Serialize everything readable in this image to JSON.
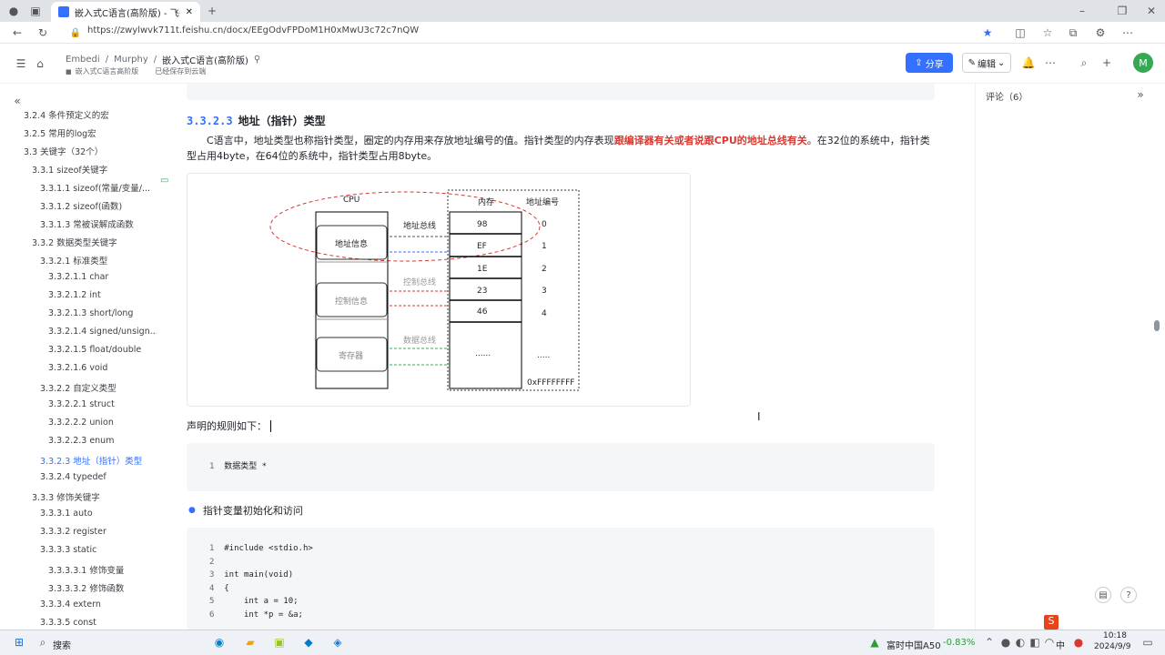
{
  "browser": {
    "tab_title": "嵌入式C语言(高阶版) - 飞书云文档",
    "url": "https://zwylwvk711t.feishu.cn/docx/EEgOdvFPDoM1H0xMwU3c72c7nQW"
  },
  "header": {
    "crumbs": [
      "Embedi",
      "Murphy",
      "嵌入式C语言(高阶版)"
    ],
    "sub_parent": "嵌入式C语言高阶版",
    "sub_status": "已经保存到云端",
    "share": "分享",
    "edit": "编辑",
    "avatar": "M"
  },
  "sidebar": {
    "items": [
      {
        "label": "3.2.4 条件预定义的宏",
        "indent": 0
      },
      {
        "label": "3.2.5 常用的log宏",
        "indent": 0
      },
      {
        "label": "3.3 关键字（32个）",
        "indent": 0
      },
      {
        "label": "3.3.1 sizeof关键字",
        "indent": 1
      },
      {
        "label": "3.3.1.1 sizeof(常量/变量/...",
        "indent": 2
      },
      {
        "label": "3.3.1.2 sizeof(函数)",
        "indent": 2
      },
      {
        "label": "3.3.1.3 常被误解成函数",
        "indent": 2
      },
      {
        "label": "3.3.2 数据类型关键字",
        "indent": 1
      },
      {
        "label": "3.3.2.1 标准类型",
        "indent": 2
      },
      {
        "label": "3.3.2.1.1 char",
        "indent": 3
      },
      {
        "label": "3.3.2.1.2 int",
        "indent": 3
      },
      {
        "label": "3.3.2.1.3 short/long",
        "indent": 3
      },
      {
        "label": "3.3.2.1.4 signed/unsign...",
        "indent": 3
      },
      {
        "label": "3.3.2.1.5 float/double",
        "indent": 3
      },
      {
        "label": "3.3.2.1.6 void",
        "indent": 3
      },
      {
        "label": "3.3.2.2 自定义类型",
        "indent": 2
      },
      {
        "label": "3.3.2.2.1 struct",
        "indent": 3
      },
      {
        "label": "3.3.2.2.2 union",
        "indent": 3
      },
      {
        "label": "3.3.2.2.3 enum",
        "indent": 3
      },
      {
        "label": "3.3.2.3 地址（指针）类型",
        "indent": 2,
        "active": true
      },
      {
        "label": "3.3.2.4 typedef",
        "indent": 2
      },
      {
        "label": "3.3.3 修饰关键字",
        "indent": 1
      },
      {
        "label": "3.3.3.1 auto",
        "indent": 2
      },
      {
        "label": "3.3.3.2 register",
        "indent": 2
      },
      {
        "label": "3.3.3.3 static",
        "indent": 2
      },
      {
        "label": "3.3.3.3.1 修饰变量",
        "indent": 3
      },
      {
        "label": "3.3.3.3.2 修饰函数",
        "indent": 3
      },
      {
        "label": "3.3.3.4 extern",
        "indent": 2
      },
      {
        "label": "3.3.3.5 const",
        "indent": 2
      }
    ]
  },
  "doc": {
    "heading_num": "3.3.2.3",
    "heading": "地址（指针）类型",
    "para_a": "C语言中，地址类型也称指针类型，圈定的内存用来存放地址编号的值。指针类型的内存表现",
    "para_red": "跟编译器有关或者说跟CPU的地址总线有关",
    "para_b": "。在32位的系统中，指针类型占用4byte，在64位的系统中，指针类型占用8byte。",
    "figure": {
      "cpu": "CPU",
      "mem": "内存",
      "addr_title": "地址编号",
      "cpu_boxes": [
        "地址信息",
        "控制信息",
        "寄存器"
      ],
      "buses": [
        "地址总线",
        "控制总线",
        "数据总线"
      ],
      "cells": [
        "98",
        "EF",
        "1E",
        "23",
        "46",
        "......"
      ],
      "addrs": [
        "0",
        "1",
        "2",
        "3",
        "4",
        "....."
      ],
      "last_addr": "0xFFFFFFFF"
    },
    "rule": "声明的规则如下：",
    "code1": [
      {
        "n": "1",
        "t": "数据类型 *"
      }
    ],
    "bullet": "指针变量初始化和访问",
    "code2": [
      {
        "n": "1",
        "t": "#include <stdio.h>"
      },
      {
        "n": "2",
        "t": ""
      },
      {
        "n": "3",
        "t": "int main(void)"
      },
      {
        "n": "4",
        "t": "{"
      },
      {
        "n": "5",
        "t": "    int a = 10;"
      },
      {
        "n": "6",
        "t": "    int *p = &a;"
      }
    ]
  },
  "comments": {
    "label": "评论（6）"
  },
  "taskbar": {
    "search": "搜索",
    "stock_name": "富时中国A50",
    "stock_change": "-0.83%",
    "ime": "中",
    "time": "10:18",
    "date": "2024/9/9"
  },
  "colors": {
    "accent": "#3370ff",
    "red": "#d83931"
  }
}
